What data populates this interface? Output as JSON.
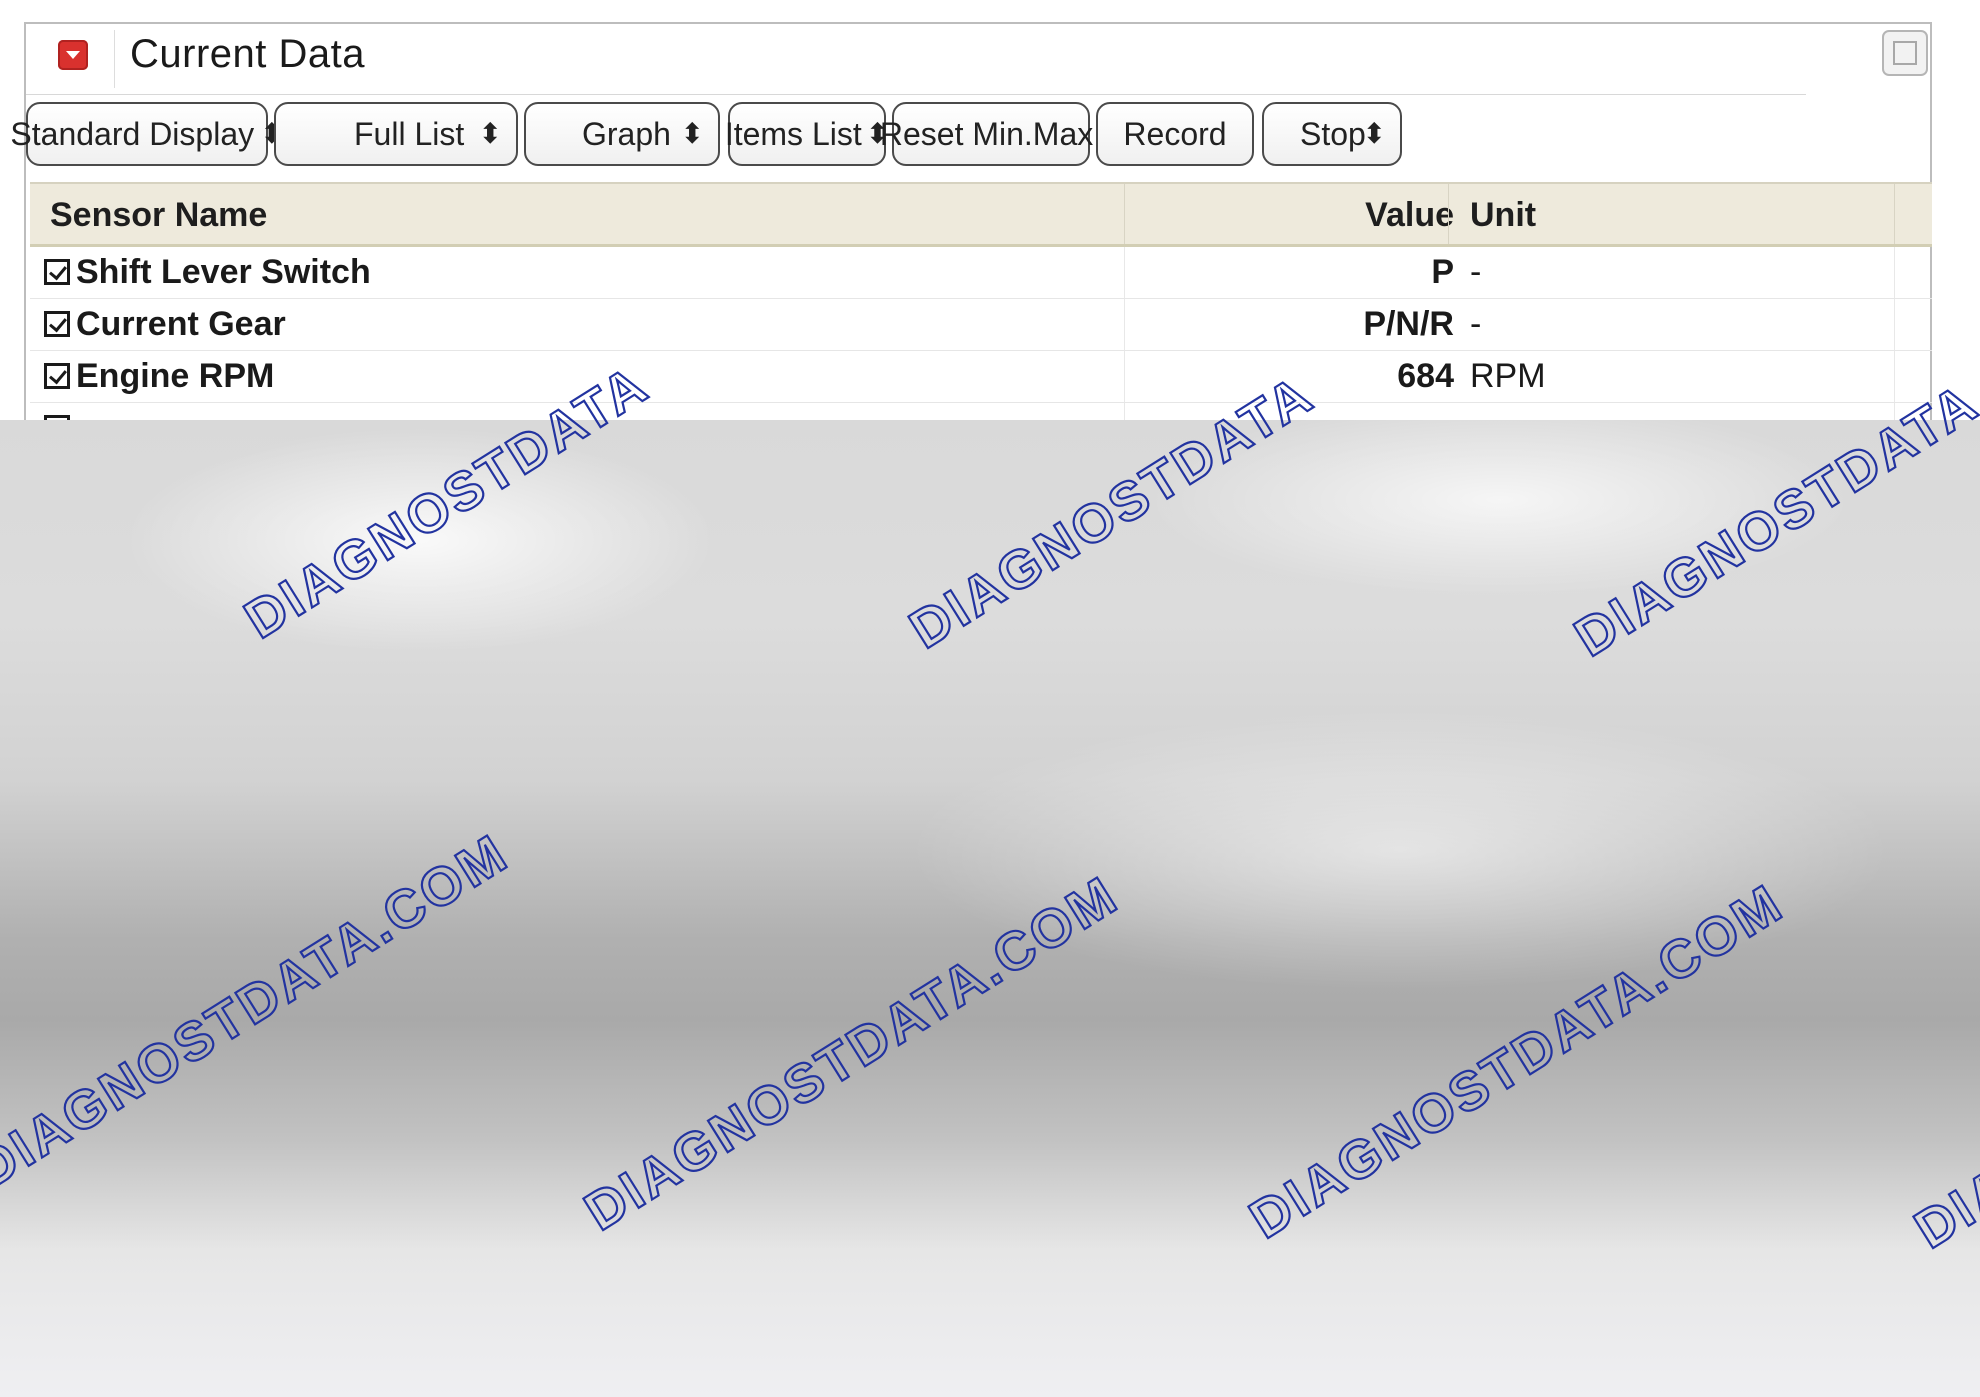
{
  "panel": {
    "title": "Current Data"
  },
  "toolbar": {
    "standard_display": "Standard Display",
    "full_list": "Full List",
    "graph": "Graph",
    "items_list": "Items List",
    "reset_min_max": "Reset Min.Max.",
    "record": "Record",
    "stop": "Stop"
  },
  "grid": {
    "headers": {
      "sensor_name": "Sensor Name",
      "value": "Value",
      "unit": "Unit"
    },
    "rows": [
      {
        "name": "Shift Lever Switch",
        "value": "P",
        "unit": "-"
      },
      {
        "name": "Current Gear",
        "value": "P/N/R",
        "unit": "-"
      },
      {
        "name": "Engine RPM",
        "value": "684",
        "unit": "RPM"
      }
    ]
  },
  "watermark": {
    "brand": "DIAGNOSTDATA",
    "domain": "DIAGNOSTDATA.COM"
  }
}
